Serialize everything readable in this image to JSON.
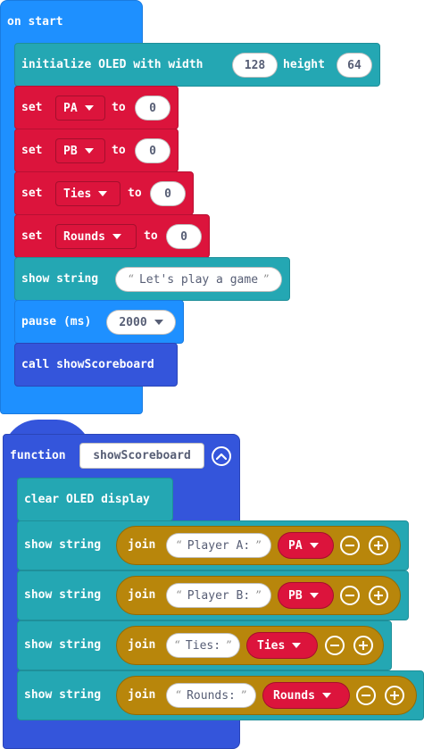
{
  "on_start": {
    "hat_label": "on start",
    "init_oled": {
      "label": "initialize OLED with width",
      "width_value": "128",
      "height_label": "height",
      "height_value": "64"
    },
    "set_blocks": [
      {
        "set_label": "set",
        "variable": "PA",
        "to_label": "to",
        "value": "0"
      },
      {
        "set_label": "set",
        "variable": "PB",
        "to_label": "to",
        "value": "0"
      },
      {
        "set_label": "set",
        "variable": "Ties",
        "to_label": "to",
        "value": "0"
      },
      {
        "set_label": "set",
        "variable": "Rounds",
        "to_label": "to",
        "value": "0"
      }
    ],
    "show_string": {
      "label": "show string",
      "text": "Let's play a game"
    },
    "pause": {
      "label": "pause (ms)",
      "value": "2000"
    },
    "call": {
      "label": "call showScoreboard"
    }
  },
  "function_def": {
    "keyword": "function",
    "name": "showScoreboard",
    "clear_oled": {
      "label": "clear OLED display"
    },
    "show_rows": [
      {
        "label": "show string",
        "join_label": "join",
        "text": "Player A:",
        "variable": "PA"
      },
      {
        "label": "show string",
        "join_label": "join",
        "text": "Player B:",
        "variable": "PB"
      },
      {
        "label": "show string",
        "join_label": "join",
        "text": "Ties:",
        "variable": "Ties"
      },
      {
        "label": "show string",
        "join_label": "join",
        "text": "Rounds:",
        "variable": "Rounds"
      }
    ]
  },
  "colors": {
    "events": "#1e90ff",
    "oled": "#24a7b3",
    "variables": "#dc143c",
    "join": "#b8860b",
    "functions": "#3455db"
  },
  "icons": [
    "chevron-up-icon",
    "minus-circle-icon",
    "plus-circle-icon",
    "dropdown-caret-icon"
  ]
}
